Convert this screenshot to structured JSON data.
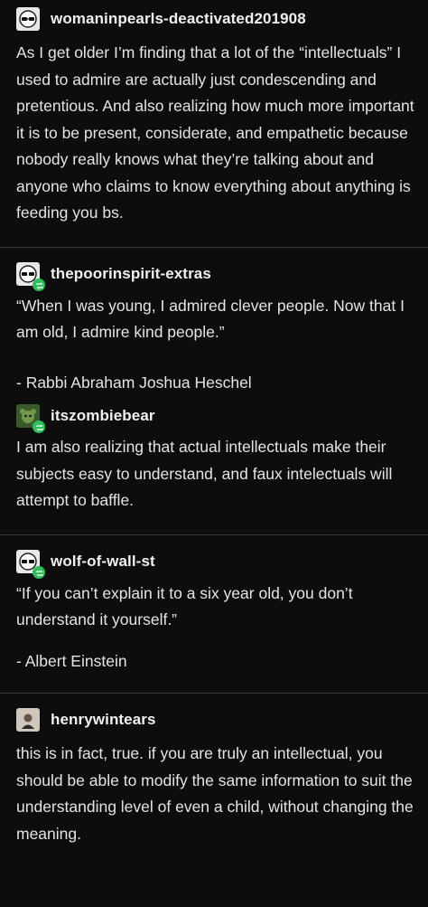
{
  "posts": [
    {
      "username": "womaninpearls-deactivated201908",
      "text": "As I get older I’m finding that a lot of the “intellectuals” I used to admire are actually just condescending and pretentious. And also realizing how much more important it is to be present, considerate, and empathetic because nobody really knows what they’re talking about and anyone who claims to know everything about anything is feeding you bs."
    },
    {
      "username": "thepoorinspirit-extras",
      "text": "“When I was young, I admired clever people. Now that I am old, I admire kind people.”",
      "attribution": "- Rabbi Abraham Joshua Heschel"
    },
    {
      "username": "itszombiebear",
      "text": "I am also realizing that actual intellectuals make their subjects easy to understand, and faux intelectuals will attempt to baffle."
    },
    {
      "username": "wolf-of-wall-st",
      "text": "“If you can’t explain it to a six year old, you don’t understand it yourself.”",
      "attribution": "- Albert Einstein"
    },
    {
      "username": "henrywintears",
      "text": "this is in fact, true. if you are truly an intellectual, you should be able to modify the same information to suit the understanding level of even a child, without changing the meaning."
    }
  ],
  "colors": {
    "background": "#0d0d0d",
    "reblog_badge": "#2ebf5a",
    "divider": "#3a3a3a"
  },
  "icons": {
    "avatar_1": "sunglasses-avatar-icon",
    "reblog": "reblog-icon"
  }
}
